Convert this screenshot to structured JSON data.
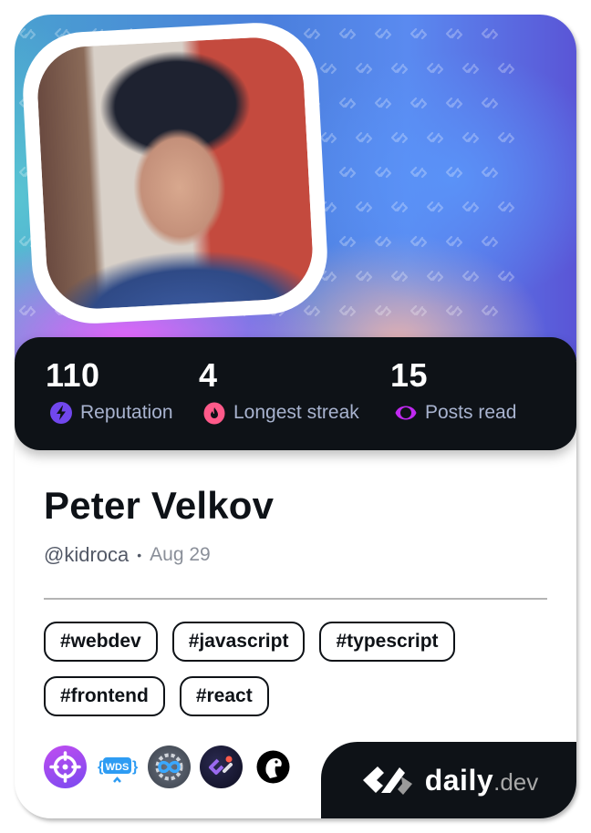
{
  "profile": {
    "name": "Peter Velkov",
    "handle": "@kidroca",
    "separator": "•",
    "joined": "Aug 29",
    "avatar": "profile-photo"
  },
  "stats": [
    {
      "value": "110",
      "label": "Reputation",
      "icon": "lightning-icon",
      "color": "#7147ed"
    },
    {
      "value": "4",
      "label": "Longest streak",
      "icon": "flame-icon",
      "color": "#ff5a8a"
    },
    {
      "value": "15",
      "label": "Posts read",
      "icon": "eye-ring-icon",
      "color": "#c029f0"
    }
  ],
  "tags": [
    "#webdev",
    "#javascript",
    "#typescript",
    "#frontend",
    "#react"
  ],
  "squads": [
    {
      "name": "target-squad-icon",
      "color": "#a64df0"
    },
    {
      "name": "wds-squad-icon",
      "color": "#2e9cf3"
    },
    {
      "name": "gear-infinity-squad-icon",
      "color": "#4a5260"
    },
    {
      "name": "dailydev-squad-icon",
      "color": "#1e1e3a"
    },
    {
      "name": "dino-squad-icon",
      "color": "#000000"
    }
  ],
  "brand": {
    "word": "daily",
    "tld": ".dev"
  },
  "colors": {
    "dark": "#0e1217",
    "label": "#a8b3cf",
    "muted": "#525866"
  }
}
